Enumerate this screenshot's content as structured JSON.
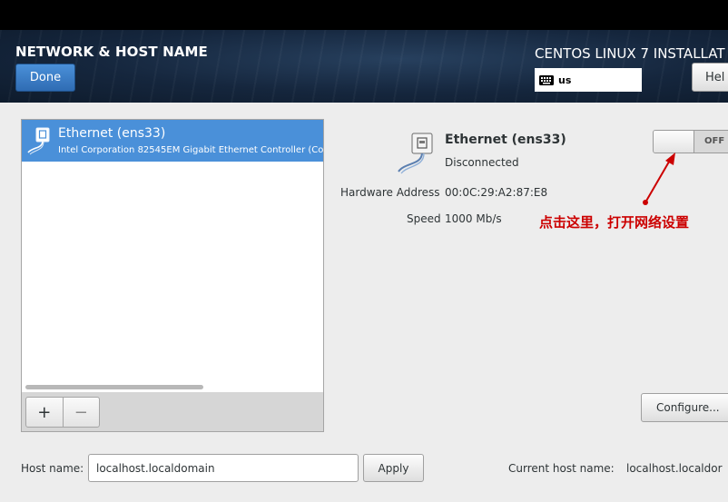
{
  "header": {
    "title": "NETWORK & HOST NAME",
    "done_label": "Done",
    "installer_title": "CENTOS LINUX 7 INSTALLAT",
    "keyboard_layout": "us",
    "help_label": "Hel"
  },
  "devices": [
    {
      "name": "Ethernet (ens33)",
      "description": "Intel Corporation 82545EM Gigabit Ethernet Controller (Cop",
      "selected": true
    }
  ],
  "list_toolbar": {
    "add_label": "+",
    "remove_label": "−"
  },
  "detail": {
    "name": "Ethernet (ens33)",
    "status": "Disconnected",
    "hw_label": "Hardware Address",
    "hw_value": "00:0C:29:A2:87:E8",
    "speed_label": "Speed",
    "speed_value": "1000 Mb/s",
    "switch_label": "OFF",
    "configure_label": "Configure..."
  },
  "annotation": {
    "text": "点击这里，打开网络设置",
    "color": "#cc0000"
  },
  "hostname": {
    "label": "Host name:",
    "value": "localhost.localdomain",
    "apply_label": "Apply",
    "current_label": "Current host name:",
    "current_value": "localhost.localdor"
  },
  "colors": {
    "accent": "#4a90d9",
    "header_bg": "#15263d",
    "annotation": "#cc0000"
  }
}
